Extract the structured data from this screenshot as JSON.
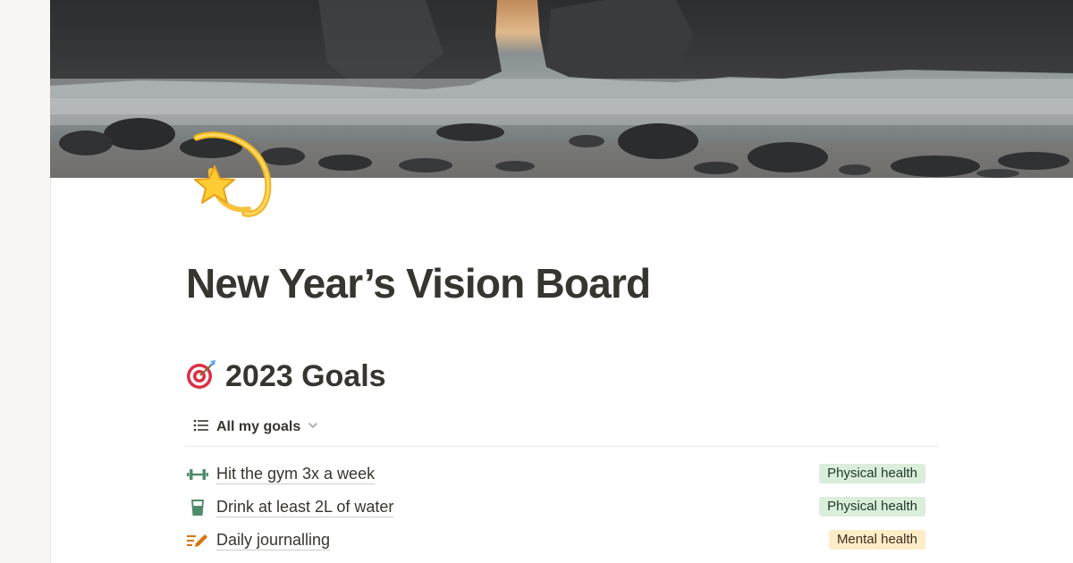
{
  "page": {
    "title": "New Year’s Vision Board",
    "icon": "dizzy-star-icon",
    "cover": "rocky-beach-sunset-cover"
  },
  "section": {
    "heading": "2023 Goals",
    "icon": "direct-hit-target-icon"
  },
  "view": {
    "label": "All my goals",
    "icon": "list-icon",
    "dropdown_icon": "chevron-down-icon"
  },
  "goals": [
    {
      "title": "Hit the gym 3x a week",
      "icon": "dumbbell-icon",
      "tag": "Physical health",
      "tag_color": "#dbeddb",
      "tag_text_color": "#1c3829"
    },
    {
      "title": "Drink at least 2L of water",
      "icon": "glass-icon",
      "tag": "Physical health",
      "tag_color": "#dbeddb",
      "tag_text_color": "#1c3829"
    },
    {
      "title": "Daily journalling",
      "icon": "pencil-note-icon",
      "tag": "Mental health",
      "tag_color": "#fdecc8",
      "tag_text_color": "#402c1b"
    }
  ],
  "colors": {
    "text": "#37352f",
    "sidebar_bg": "#f7f6f3",
    "green_icon": "#4f8c6b",
    "orange_icon": "#d9730d"
  }
}
